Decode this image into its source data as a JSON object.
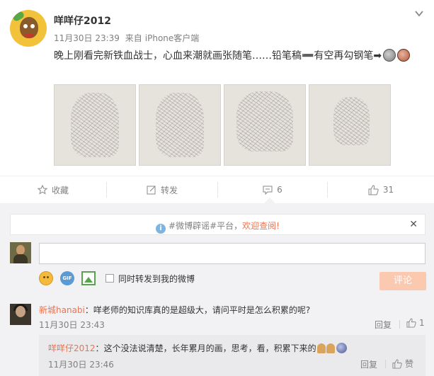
{
  "post": {
    "author": "咩咩仔2012",
    "time": "11月30日 23:39",
    "source_prefix": "来自",
    "source": "iPhone客户端",
    "text": "晚上刚看完新铁血战士，心血来潮就画张随笔……铅笔稿➖有空再勾钢笔➡",
    "photo_count": 4
  },
  "actions": {
    "favorite": "收藏",
    "repost": "转发",
    "comment_count": "6",
    "like_count": "31"
  },
  "notice": {
    "tag": "#微博辟谣#平台，",
    "link": "欢迎查阅!"
  },
  "composer": {
    "forward_label": "同时转发到我的微博",
    "submit_label": "评论"
  },
  "comments": [
    {
      "name": "新城hanabi",
      "text": "咩老师的知识库真的是超级大，请问平时是怎么积累的呢?",
      "time": "11月30日 23:43",
      "reply_label": "回复",
      "likes": "1"
    }
  ],
  "reply": {
    "name": "咩咩仔2012",
    "text": "这个没法说清楚，长年累月的画，思考，看，积累下来的",
    "time": "11月30日 23:46",
    "reply_label": "回复",
    "like_label": "赞"
  },
  "colors": {
    "accent": "#eb7350",
    "muted": "#808080",
    "panel": "#f2f2f5",
    "submit": "#fbc8b0"
  }
}
